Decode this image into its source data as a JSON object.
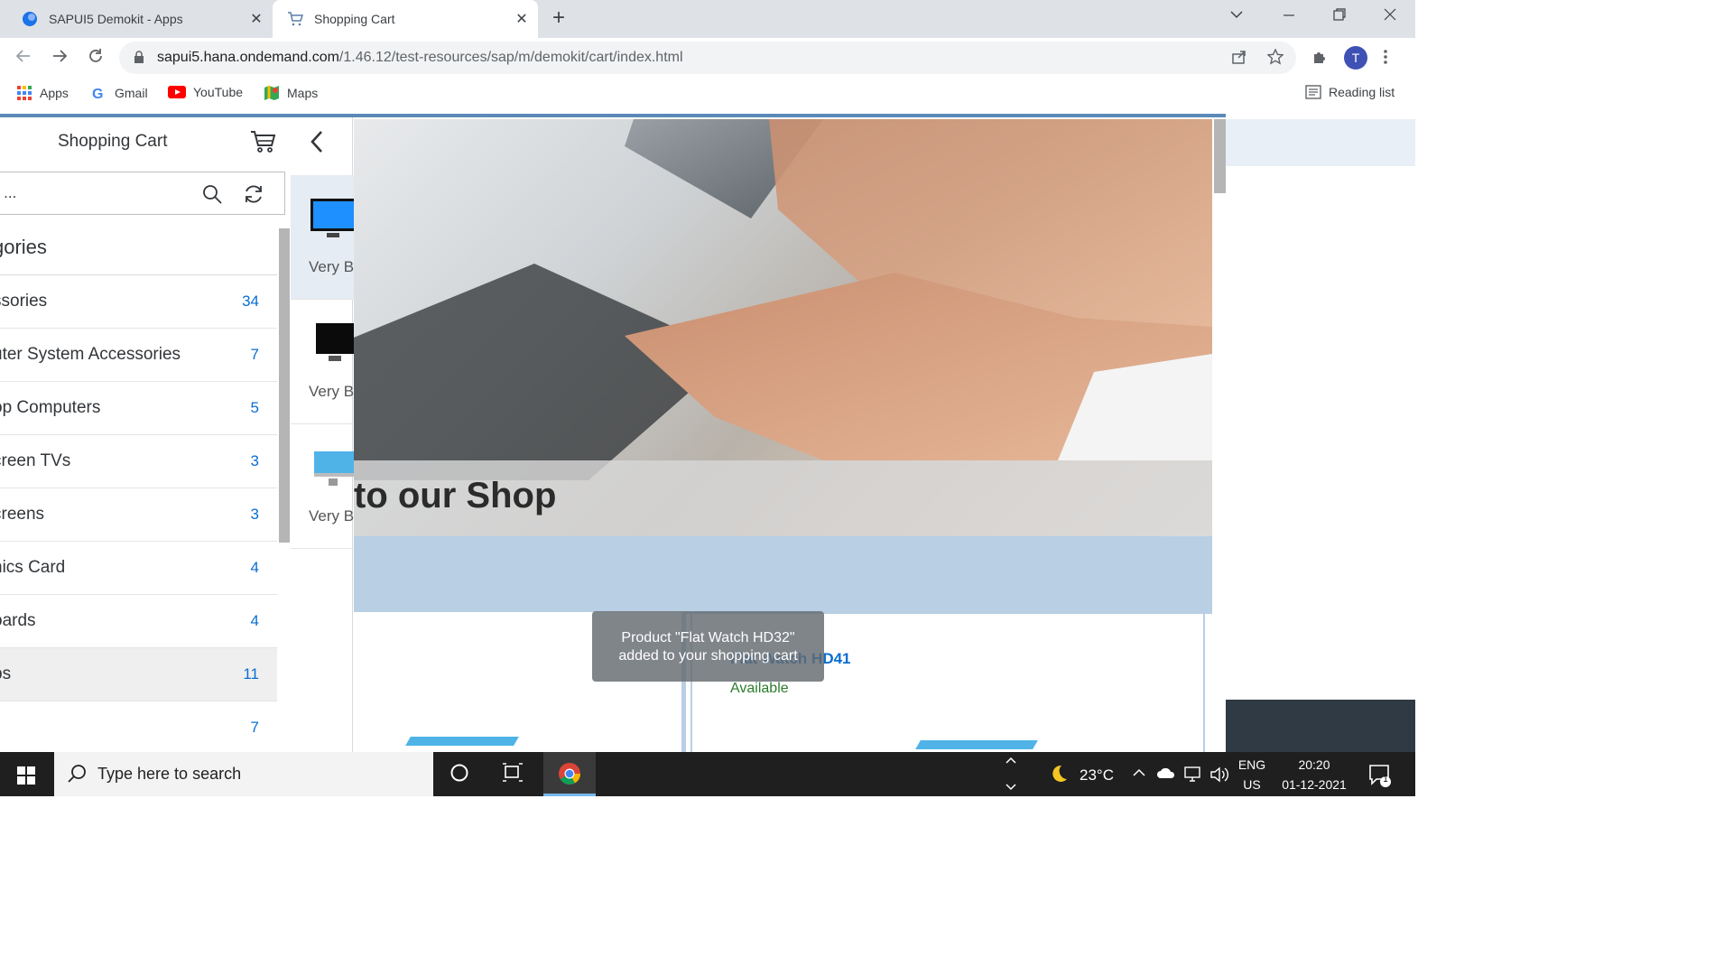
{
  "browser": {
    "tabs": [
      {
        "label": "SAPUI5 Demokit - Apps",
        "active": false
      },
      {
        "label": "Shopping Cart",
        "active": true
      }
    ],
    "url_host": "sapui5.hana.ondemand.com",
    "url_path": "/1.46.12/test-resources/sap/m/demokit/cart/index.html",
    "profile_initial": "T",
    "bookmarks": [
      "Apps",
      "Gmail",
      "YouTube",
      "Maps"
    ],
    "reading_list": "Reading list"
  },
  "master": {
    "title": "Shopping Cart",
    "search_value": "h ...",
    "categories_header": "gories",
    "categories": [
      {
        "name": "ssories",
        "count": "34"
      },
      {
        "name": "uter System Accessories",
        "count": "7"
      },
      {
        "name": "op Computers",
        "count": "5"
      },
      {
        "name": "creen TVs",
        "count": "3"
      },
      {
        "name": "creens",
        "count": "3"
      },
      {
        "name": "hics Card",
        "count": "4"
      },
      {
        "name": "oards",
        "count": "4"
      },
      {
        "name": "ps",
        "count": "11"
      },
      {
        "name": "",
        "count": "7"
      }
    ]
  },
  "product_strip": [
    {
      "label": "Very B"
    },
    {
      "label": "Very B"
    },
    {
      "label": "Very B"
    }
  ],
  "detail": {
    "hero_title": "to our Shop",
    "product_name": "Flat Watch HD41",
    "availability": "Available"
  },
  "toast": {
    "line1": "Product \"Flat Watch HD32\"",
    "line2": "added to your shopping cart"
  },
  "taskbar": {
    "search_placeholder": "Type here to search",
    "temperature": "23°C",
    "lang_top": "ENG",
    "lang_bottom": "US",
    "time": "20:20",
    "date": "01-12-2021",
    "notification_count": "1"
  },
  "colors": {
    "accent_blue": "#0a6ed1",
    "band_blue": "#b8cfe4",
    "available_green": "#2b7c2b"
  }
}
